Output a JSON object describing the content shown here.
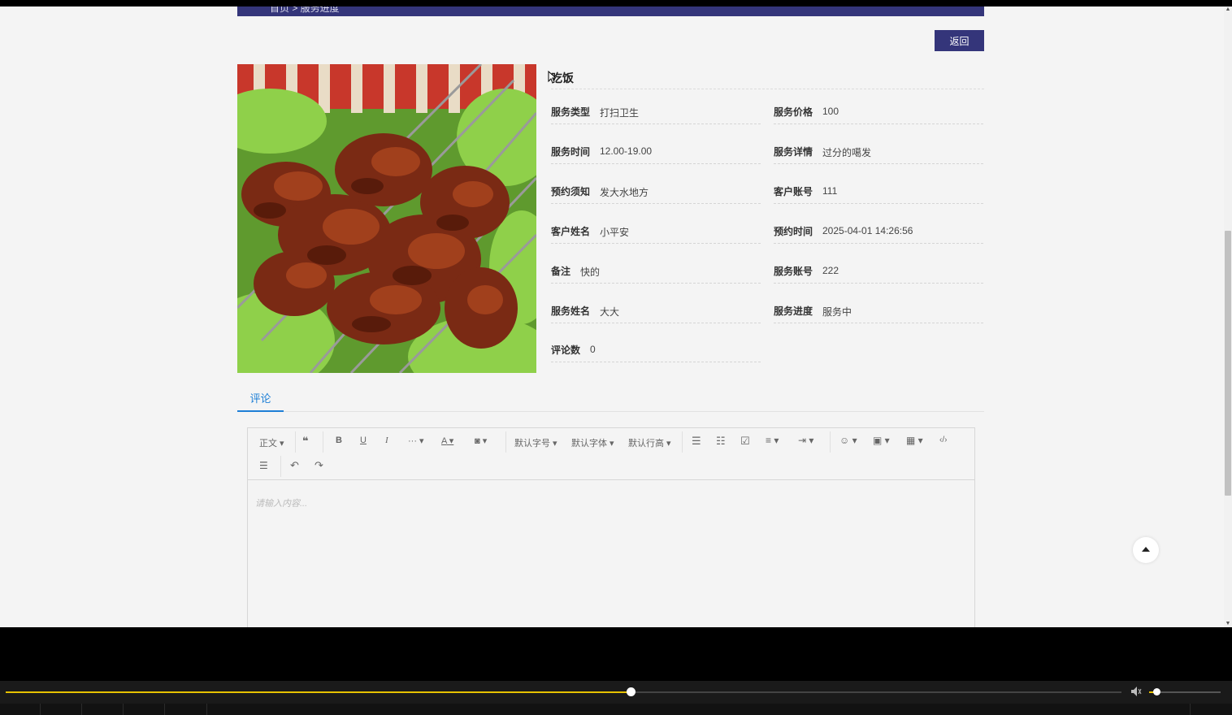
{
  "breadcrumb": {
    "text": "首页 > 服务进度"
  },
  "back_button": "返回",
  "service": {
    "title": "吃饭",
    "fields_left": [
      {
        "label": "服务类型",
        "value": "打扫卫生"
      },
      {
        "label": "服务时间",
        "value": "12.00-19.00"
      },
      {
        "label": "预约须知",
        "value": "发大水地方"
      },
      {
        "label": "客户姓名",
        "value": "小平安"
      },
      {
        "label": "备注",
        "value": "快的"
      },
      {
        "label": "服务姓名",
        "value": "大大"
      },
      {
        "label": "评论数",
        "value": "0"
      }
    ],
    "fields_right": [
      {
        "label": "服务价格",
        "value": "100"
      },
      {
        "label": "服务详情",
        "value": "过分的噶发"
      },
      {
        "label": "客户账号",
        "value": "111"
      },
      {
        "label": "预约时间",
        "value": "2025-04-01 14:26:56"
      },
      {
        "label": "服务账号",
        "value": "222"
      },
      {
        "label": "服务进度",
        "value": "服务中"
      }
    ]
  },
  "tabs": {
    "comment": "评论"
  },
  "editor": {
    "heading_select": "正文",
    "font_size_select": "默认字号",
    "font_family_select": "默认字体",
    "line_height_select": "默认行高",
    "placeholder": "请输入内容...",
    "more_label": "···",
    "text_color_label": "A",
    "bold_label": "B",
    "underline_label": "U",
    "italic_label": "I",
    "code_label": "‹/›"
  },
  "player": {
    "progress_fraction": 0.56,
    "volume_fraction": 0.1
  },
  "colors": {
    "brand_dark": "#34357a",
    "tab_blue": "#1e7fd6",
    "progress_yellow": "#e6c200"
  }
}
